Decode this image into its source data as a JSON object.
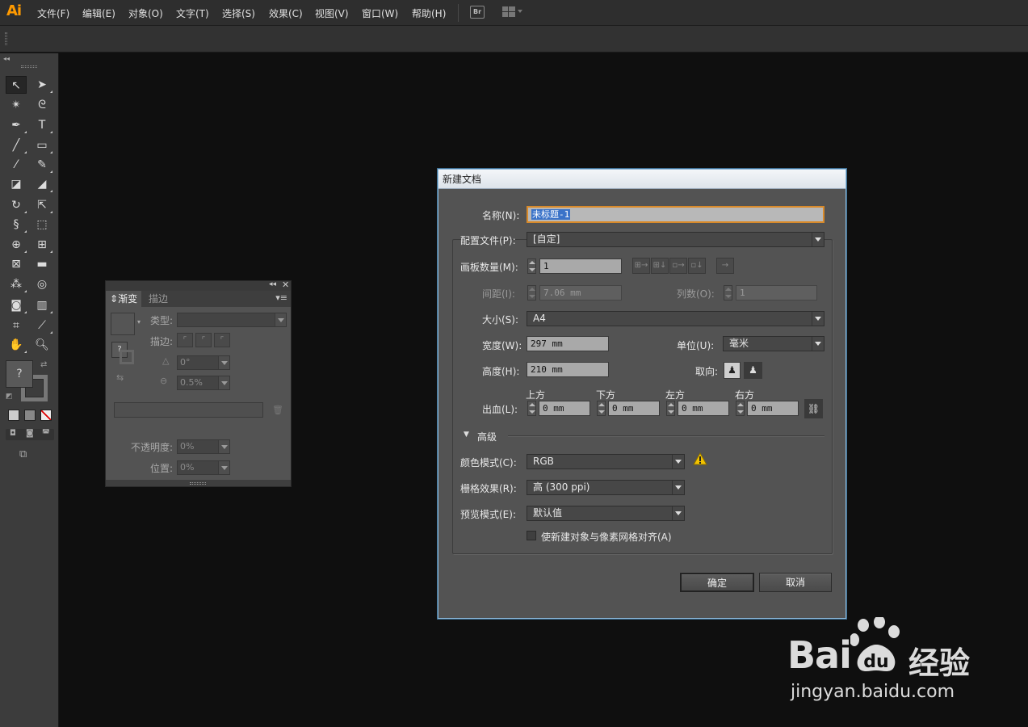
{
  "app": {
    "logo": "Ai"
  },
  "menu": [
    "文件(F)",
    "编辑(E)",
    "对象(O)",
    "文字(T)",
    "选择(S)",
    "效果(C)",
    "视图(V)",
    "窗口(W)",
    "帮助(H)"
  ],
  "menubar_extra": {
    "bridge": "Br"
  },
  "gradient_panel": {
    "tab_gradient": "渐变",
    "tab_stroke": "描边",
    "type_label": "类型:",
    "stroke_label": "描边:",
    "angle_value": "0°",
    "ratio_value": "0.5%",
    "opacity_label": "不透明度:",
    "opacity_value": "0%",
    "location_label": "位置:",
    "location_value": "0%",
    "swatch_question": "?"
  },
  "toolbox": {
    "fill_question": "?"
  },
  "dialog": {
    "title": "新建文档",
    "name_label": "名称(N):",
    "name_value": "未标题-1",
    "profile_label": "配置文件(P):",
    "profile_value": "[自定]",
    "artboards_label": "画板数量(M):",
    "artboards_value": "1",
    "spacing_label": "间距(I):",
    "spacing_value": "7.06 mm",
    "columns_label": "列数(O):",
    "columns_value": "1",
    "size_label": "大小(S):",
    "size_value": "A4",
    "width_label": "宽度(W):",
    "width_value": "297 mm",
    "units_label": "单位(U):",
    "units_value": "毫米",
    "height_label": "高度(H):",
    "height_value": "210 mm",
    "orientation_label": "取向:",
    "bleed_label": "出血(L):",
    "bleed_top_label": "上方",
    "bleed_bottom_label": "下方",
    "bleed_left_label": "左方",
    "bleed_right_label": "右方",
    "bleed_top": "0 mm",
    "bleed_bottom": "0 mm",
    "bleed_left": "0 mm",
    "bleed_right": "0 mm",
    "advanced_label": "高级",
    "color_mode_label": "颜色模式(C):",
    "color_mode_value": "RGB",
    "raster_label": "栅格效果(R):",
    "raster_value": "高 (300 ppi)",
    "preview_label": "预览模式(E):",
    "preview_value": "默认值",
    "align_pixel_label": "使新建对象与像素网格对齐(A)",
    "ok": "确定",
    "cancel": "取消"
  },
  "watermark": {
    "brand": "Bai",
    "brand2": "经验",
    "url": "jingyan.baidu.com"
  },
  "colors": {
    "accent": "#ff9a00",
    "dialog_border": "#8fb8d8",
    "warning": "#f2c200"
  }
}
